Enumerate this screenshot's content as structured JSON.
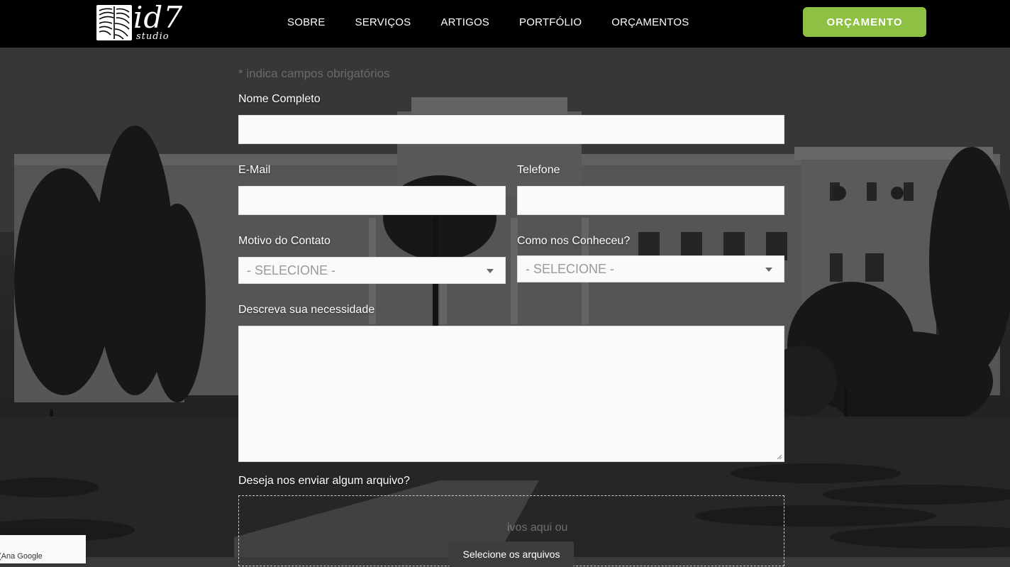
{
  "header": {
    "logo_text": "id7",
    "logo_sub": "studio",
    "nav": [
      "SOBRE",
      "SERVIÇOS",
      "ARTIGOS",
      "PORTFÓLIO",
      "ORÇAMENTOS"
    ],
    "cta_label": "ORÇAMENTO"
  },
  "form": {
    "required_note": "* indica campos obrigatórios",
    "name_label": "Nome Completo",
    "email_label": "E-Mail",
    "phone_label": "Telefone",
    "reason_label": "Motivo do Contato",
    "reason_value": "- SELECIONE -",
    "source_label": "Como nos Conheceu?",
    "source_value": "- SELECIONE -",
    "description_label": "Descreva sua necessidade",
    "file_label": "Deseja nos enviar algum arquivo?",
    "drop_text": "ivos aqui ou",
    "file_button": "Selecione os arquivos"
  },
  "recaptcha": {
    "text": "(Ana Google"
  },
  "colors": {
    "accent": "#8dc043",
    "header_bg": "#000000"
  }
}
